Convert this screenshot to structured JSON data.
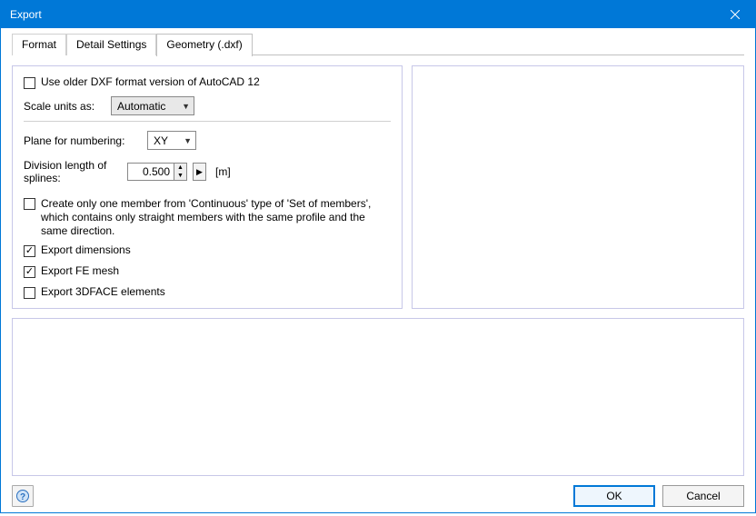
{
  "window": {
    "title": "Export"
  },
  "tabs": {
    "format": "Format",
    "detail": "Detail Settings",
    "geometry": "Geometry (.dxf)"
  },
  "options": {
    "older_dxf": "Use older DXF format version of AutoCAD 12",
    "scale_label": "Scale units as:",
    "scale_value": "Automatic",
    "plane_label": "Plane for numbering:",
    "plane_value": "XY",
    "division_label": "Division length of splines:",
    "division_value": "0.500",
    "division_unit": "[m]",
    "create_one_member": "Create only one member from 'Continuous' type of 'Set of members', which contains only straight members with the same profile and the same direction.",
    "export_dimensions": "Export dimensions",
    "export_fe_mesh": "Export FE mesh",
    "export_3dface": "Export 3DFACE elements"
  },
  "buttons": {
    "ok": "OK",
    "cancel": "Cancel"
  }
}
